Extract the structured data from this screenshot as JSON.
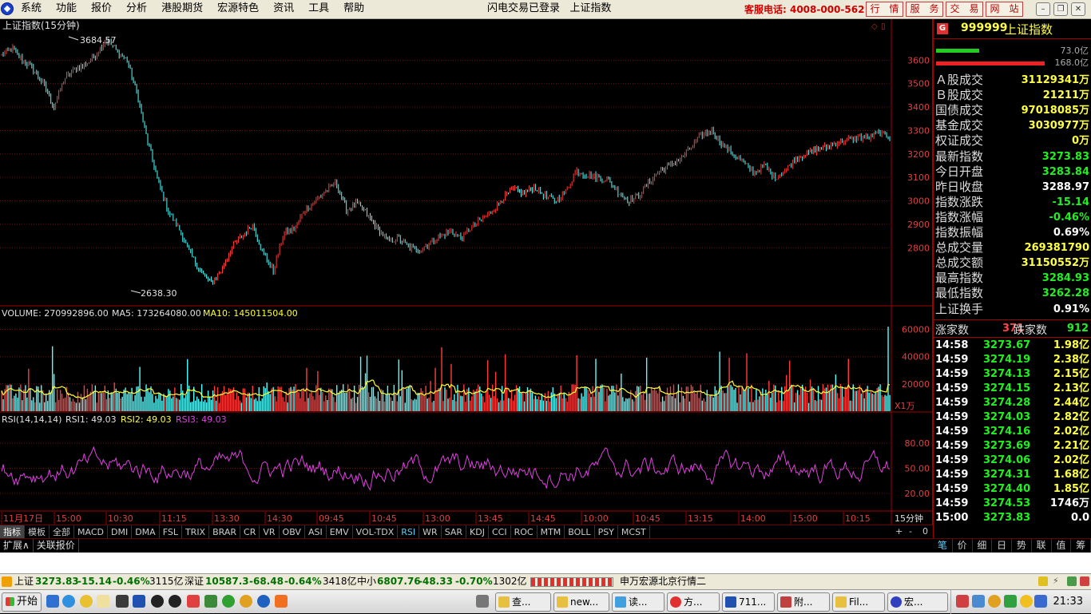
{
  "menubar": {
    "items": [
      "系统",
      "功能",
      "报价",
      "分析",
      "港股期货",
      "宏源特色",
      "资讯",
      "工具",
      "帮助"
    ],
    "login_status": "闪电交易已登录",
    "current": "上证指数",
    "hotline": "客服电话: 4008-000-562",
    "buttons": [
      "行　情",
      "服　务",
      "交　易",
      "网　站"
    ]
  },
  "chart": {
    "title": "上证指数(15分钟)",
    "price_high_label": "3684.57",
    "price_low_label": "2638.30",
    "price_ticks": [
      "3600",
      "3500",
      "3400",
      "3300",
      "3200",
      "3100",
      "3000",
      "2900",
      "2800"
    ],
    "volume_label": "VOLUME: 270992896.00",
    "ma5_label": "MA5: 173264080.00",
    "ma10_label": "MA10: 145011504.00",
    "volume_ticks": [
      "60000",
      "40000",
      "20000"
    ],
    "volume_unit": "X1万",
    "rsi_label": "RSI(14,14,14)",
    "rsi1_label": "RSI1: 49.03",
    "rsi2_label": "RSI2: 49.03",
    "rsi3_label": "RSI3: 49.03",
    "rsi_ticks": [
      "80.00",
      "50.00",
      "20.00"
    ],
    "time_labels": [
      "11月17日",
      "15:00",
      "10:30",
      "11:15",
      "13:30",
      "14:30",
      "09:45",
      "10:45",
      "13:00",
      "13:45",
      "14:45",
      "10:00",
      "10:45",
      "13:15",
      "14:00",
      "15:00",
      "10:15"
    ],
    "period_label": "15分钟"
  },
  "chart_data": {
    "type": "candlestick",
    "title": "上证指数(15分钟)",
    "ylim": [
      2600,
      3700
    ],
    "annotations": {
      "high": 3684.57,
      "low": 2638.3
    },
    "volume_ylim": [
      0,
      65000
    ],
    "rsi_ylim": [
      0,
      100
    ],
    "rsi_levels": [
      20,
      50,
      80
    ],
    "close_path": [
      3620,
      3650,
      3600,
      3560,
      3500,
      3400,
      3520,
      3560,
      3580,
      3620,
      3690,
      3640,
      3600,
      3450,
      3250,
      3080,
      2950,
      2880,
      2780,
      2700,
      2650,
      2700,
      2800,
      2850,
      2900,
      2780,
      2700,
      2860,
      2880,
      2960,
      3000,
      3040,
      3080,
      2960,
      2990,
      2940,
      2880,
      2830,
      2840,
      2800,
      2790,
      2820,
      2850,
      2870,
      2840,
      2890,
      2920,
      2960,
      3010,
      3050,
      3030,
      3060,
      3020,
      3000,
      3040,
      3130,
      3110,
      3100,
      3090,
      3040,
      3000,
      3020,
      3080,
      3130,
      3150,
      3180,
      3230,
      3280,
      3300,
      3240,
      3200,
      3160,
      3120,
      3150,
      3100,
      3130,
      3180,
      3200,
      3220,
      3230,
      3250,
      3260,
      3270,
      3270,
      3290,
      3273.83
    ],
    "tick_table": [
      {
        "time": "14:58",
        "price": "3273.67",
        "vol": "1.98亿"
      },
      {
        "time": "14:59",
        "price": "3274.19",
        "vol": "2.38亿"
      },
      {
        "time": "14:59",
        "price": "3274.13",
        "vol": "2.15亿"
      },
      {
        "time": "14:59",
        "price": "3274.15",
        "vol": "2.13亿"
      },
      {
        "time": "14:59",
        "price": "3274.28",
        "vol": "2.44亿"
      },
      {
        "time": "14:59",
        "price": "3274.03",
        "vol": "2.82亿"
      },
      {
        "time": "14:59",
        "price": "3274.16",
        "vol": "2.02亿"
      },
      {
        "time": "14:59",
        "price": "3273.69",
        "vol": "2.21亿"
      },
      {
        "time": "14:59",
        "price": "3274.06",
        "vol": "2.02亿"
      },
      {
        "time": "14:59",
        "price": "3274.31",
        "vol": "1.68亿"
      },
      {
        "time": "14:59",
        "price": "3274.40",
        "vol": "1.85亿"
      },
      {
        "time": "14:59",
        "price": "3274.53",
        "vol": "1746万"
      },
      {
        "time": "15:00",
        "price": "3273.83",
        "vol": "0.0"
      }
    ]
  },
  "side": {
    "code": "999999",
    "name": "上证指数",
    "bar_top_label": "73.0亿",
    "bar_bottom_label": "168.0亿",
    "rows": [
      {
        "label": "Ａ股成交",
        "value": "31129341万",
        "color": "y"
      },
      {
        "label": "Ｂ股成交",
        "value": "21211万",
        "color": "y"
      },
      {
        "label": "国债成交",
        "value": "97018085万",
        "color": "y"
      },
      {
        "label": "基金成交",
        "value": "3030977万",
        "color": "y"
      },
      {
        "label": "权证成交",
        "value": "0万",
        "color": "y"
      },
      {
        "label": "最新指数",
        "value": "3273.83",
        "color": "g"
      },
      {
        "label": "今日开盘",
        "value": "3283.84",
        "color": "g"
      },
      {
        "label": "昨日收盘",
        "value": "3288.97",
        "color": "w"
      },
      {
        "label": "指数涨跌",
        "value": "-15.14",
        "color": "g"
      },
      {
        "label": "指数涨幅",
        "value": "-0.46%",
        "color": "g"
      },
      {
        "label": "指数振幅",
        "value": "0.69%",
        "color": "w"
      },
      {
        "label": "总成交量",
        "value": "269381790",
        "color": "y"
      },
      {
        "label": "总成交额",
        "value": "31150552万",
        "color": "y"
      },
      {
        "label": "最高指数",
        "value": "3284.93",
        "color": "g"
      },
      {
        "label": "最低指数",
        "value": "3262.28",
        "color": "g"
      },
      {
        "label": "上证换手",
        "value": "0.91%",
        "color": "w"
      }
    ],
    "up_label": "涨家数",
    "up_count": "371",
    "down_label": "跌家数",
    "down_count": "912",
    "tabs": [
      "笔",
      "价",
      "细",
      "日",
      "势",
      "联",
      "值",
      "筹"
    ]
  },
  "indicator_tabs": [
    "指标",
    "模板",
    "全部",
    "MACD",
    "DMI",
    "DMA",
    "FSL",
    "TRIX",
    "BRAR",
    "CR",
    "VR",
    "OBV",
    "ASI",
    "EMV",
    "VOL-TDX",
    "RSI",
    "WR",
    "SAR",
    "KDJ",
    "CCI",
    "ROC",
    "MTM",
    "BOLL",
    "PSY",
    "MCST"
  ],
  "indicator_active": "RSI",
  "indicator_right": [
    "+",
    "-",
    "0"
  ],
  "row2_tabs": [
    "扩展∧",
    "关联报价"
  ],
  "statusbar": {
    "sh_label": "上证",
    "sh_value": "3273.83",
    "sh_change": "-15.14",
    "sh_pct": "-0.46%",
    "sh_amount": "3115亿",
    "sz_label": "深证",
    "sz_value": "10587.3",
    "sz_change": "-68.48",
    "sz_pct": "-0.64%",
    "sz_amount": "3418亿",
    "zx_label": "中小",
    "zx_value": "6807.76",
    "zx_change": "-48.33",
    "zx_pct": "-0.70%",
    "zx_amount": "1302亿",
    "server": "申万宏源北京行情二"
  },
  "taskbar": {
    "start": "开始",
    "tasks": [
      "查...",
      "new...",
      "读...",
      "方...",
      "711...",
      "附...",
      "Fil...",
      "宏..."
    ],
    "clock": "21:33"
  }
}
